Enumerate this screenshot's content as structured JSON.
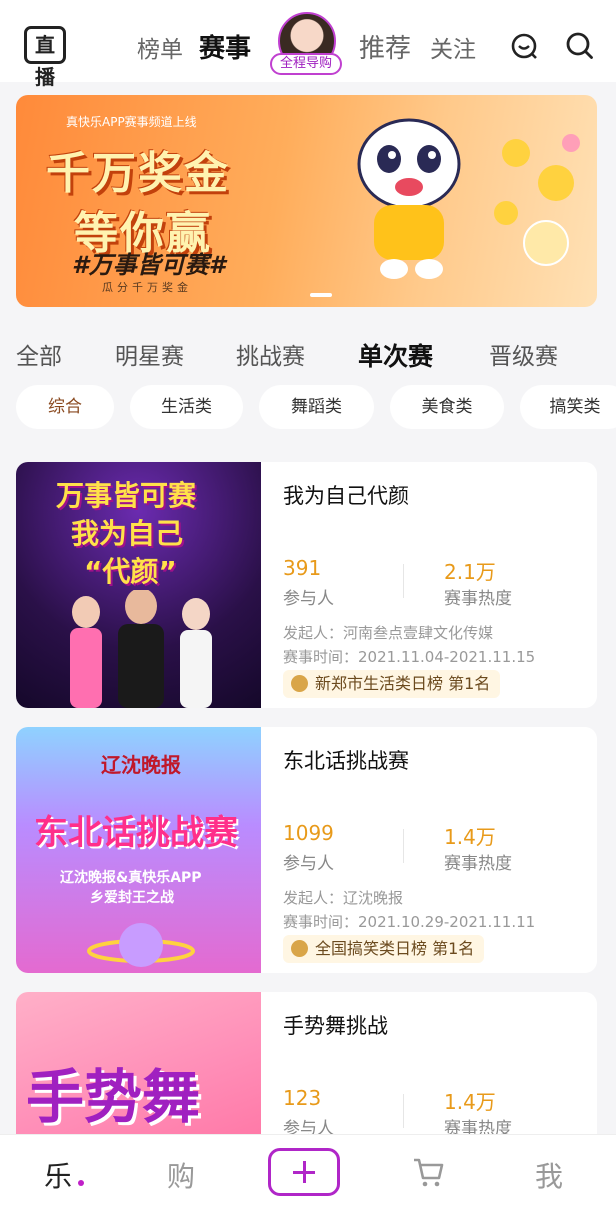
{
  "header": {
    "logo_text": "直播",
    "tabs": [
      "榜单",
      "赛事",
      "推荐",
      "关注"
    ],
    "active_tab": "赛事",
    "host_badge": "全程导购"
  },
  "banner": {
    "tag": "真快乐APP赛事频道上线",
    "headline_1": "千万奖金",
    "headline_2": "等你赢",
    "slogan": "#万事皆可赛#",
    "subline": "瓜分千万奖金"
  },
  "categories": {
    "tabs": [
      "全部",
      "明星赛",
      "挑战赛",
      "单次赛",
      "晋级赛"
    ],
    "active": "单次赛"
  },
  "filters": {
    "chips": [
      "综合",
      "生活类",
      "舞蹈类",
      "美食类",
      "搞笑类"
    ],
    "active": "综合"
  },
  "events": [
    {
      "title": "我为自己代颜",
      "participants": "391",
      "participants_label": "参与人",
      "heat": "2.1万",
      "heat_label": "赛事热度",
      "initiator": "发起人：河南叁点壹肆文化传媒",
      "time": "赛事时间：2021.11.04-2021.11.15",
      "rank": "新郑市生活类日榜 第1名",
      "thumb_text_1": "万事皆可赛",
      "thumb_text_2": "我为自己",
      "thumb_text_3": "“代颜”"
    },
    {
      "title": "东北话挑战赛",
      "participants": "1099",
      "participants_label": "参与人",
      "heat": "1.4万",
      "heat_label": "赛事热度",
      "initiator": "发起人：辽沈晚报",
      "time": "赛事时间：2021.10.29-2021.11.11",
      "rank": "全国搞笑类日榜 第1名",
      "thumb_text_1": "辽沈晚报",
      "thumb_text_2": "东北话挑战赛",
      "thumb_text_3": "辽沈晚报&真快乐APP",
      "thumb_text_4": "乡爱封王之战"
    },
    {
      "title": "手势舞挑战",
      "participants": "123",
      "participants_label": "参与人",
      "heat": "1.4万",
      "heat_label": "赛事热度",
      "thumb_text_1": "手势舞"
    }
  ],
  "bottom_nav": {
    "items": [
      "乐",
      "购",
      "我"
    ],
    "active": "乐"
  },
  "colors": {
    "accent": "#b026c8",
    "number": "#e89a1a",
    "banner": "#ff8a3a"
  }
}
